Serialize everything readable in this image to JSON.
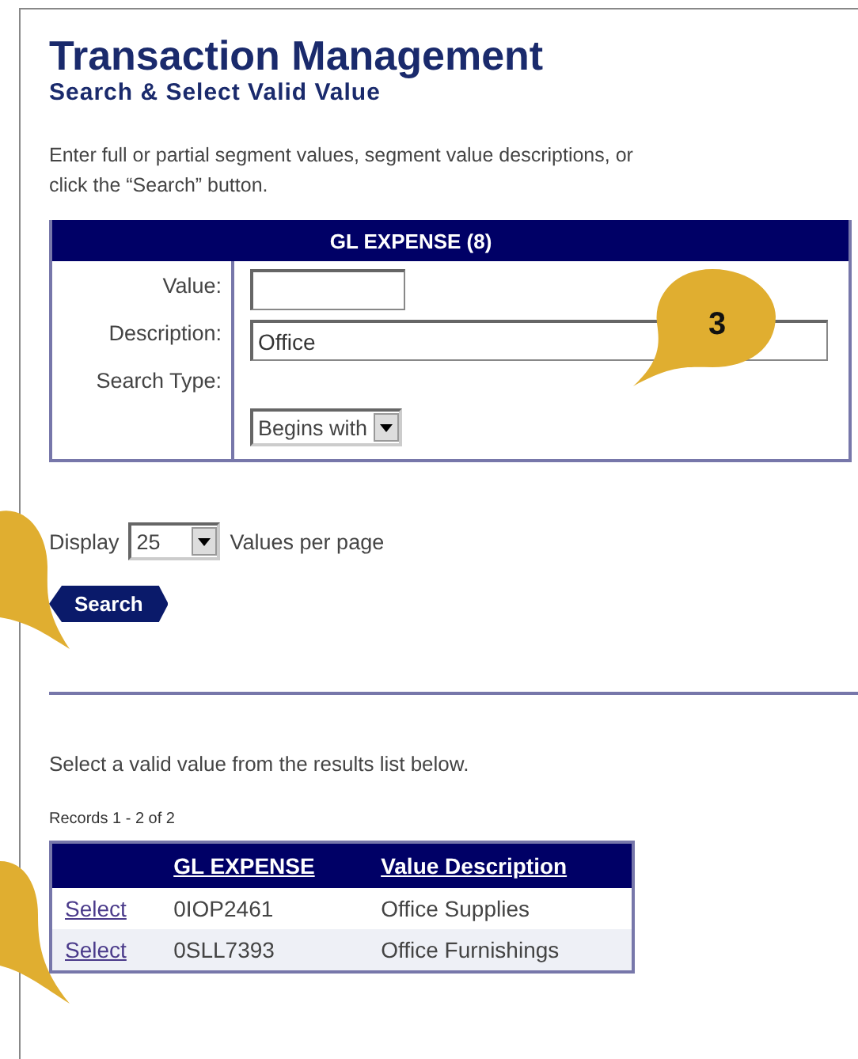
{
  "title": "Transaction Management",
  "subtitle": "Search & Select Valid Value",
  "intro_lines": [
    "Enter full or partial segment values, segment value descriptions, or",
    "click the “Search” button."
  ],
  "form": {
    "header": "GL EXPENSE (8)",
    "value_label": "Value:",
    "description_label": "Description:",
    "description_value": "Office",
    "search_type_label": "Search Type:",
    "search_type": "Begins with"
  },
  "display": {
    "label": "Display",
    "count": "25",
    "suffix": "Values per page"
  },
  "search_button": "Search",
  "results_prompt": "Select a valid value from the results list below.",
  "records": "Records 1 - 2 of 2",
  "results": {
    "columns": [
      "GL EXPENSE",
      "Value Description"
    ],
    "rows": [
      {
        "action": "Select",
        "code": "0IOP2461",
        "description": "Office Supplies"
      },
      {
        "action": "Select",
        "code": "0SLL7393",
        "description": "Office Furnishings"
      }
    ]
  },
  "callout": {
    "number": "3"
  }
}
